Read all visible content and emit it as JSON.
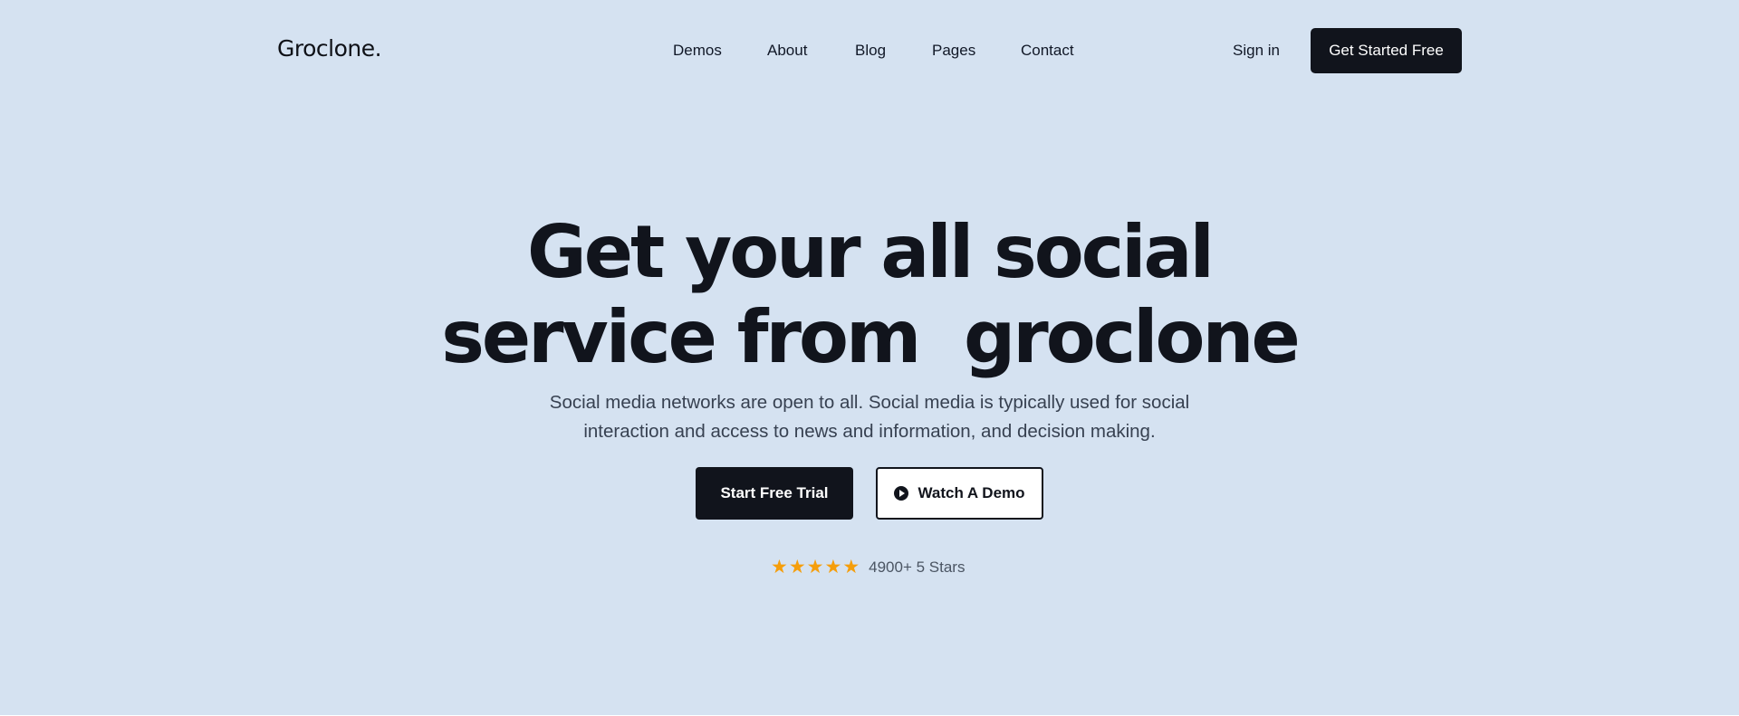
{
  "brand": {
    "logo": "Groclone."
  },
  "nav": {
    "items": [
      "Demos",
      "About",
      "Blog",
      "Pages",
      "Contact"
    ],
    "sign_in": "Sign in",
    "cta": "Get Started Free"
  },
  "hero": {
    "headline_line1": "Get your all social",
    "headline_line2": "service from  groclone",
    "subtitle_line1": "Social media networks are open to all. Social media is typically used for social",
    "subtitle_line2": "interaction and access to news and information, and decision making.",
    "primary_button": "Start Free Trial",
    "secondary_button": "Watch A Demo",
    "rating": {
      "stars": 5,
      "star_icon": "star-icon",
      "text": "4900+ 5 Stars"
    }
  },
  "colors": {
    "hero_background": "#d5e2f1",
    "dark": "#11141c",
    "star": "#f59e0b"
  }
}
